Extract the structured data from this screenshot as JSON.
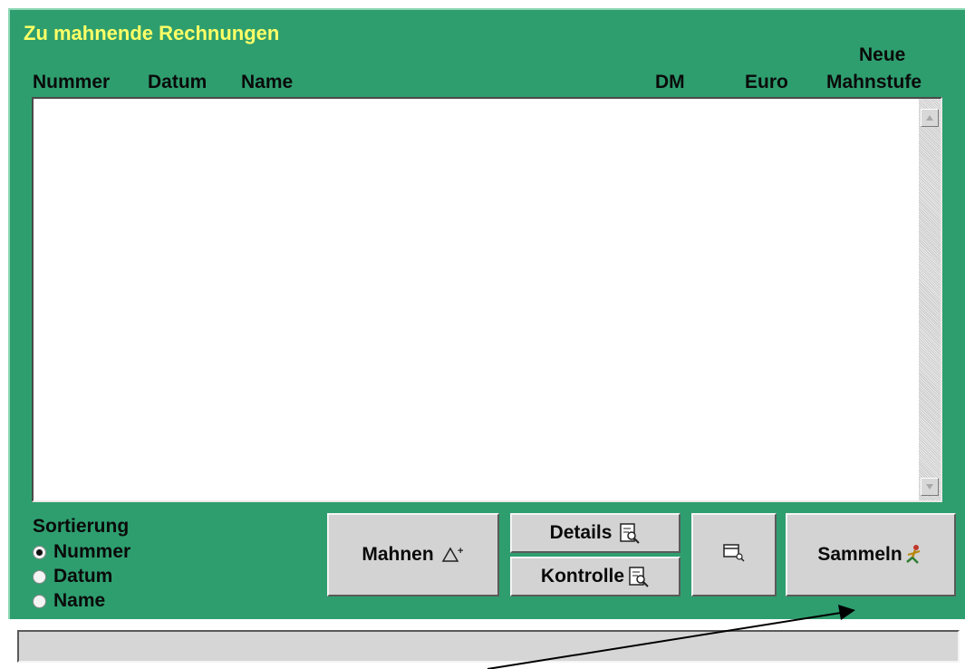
{
  "window": {
    "title": "Zu mahnende Rechnungen"
  },
  "columns": {
    "nummer": "Nummer",
    "datum": "Datum",
    "name": "Name",
    "dm": "DM",
    "euro": "Euro",
    "neue_line1": "Neue",
    "neue_line2": "Mahnstufe"
  },
  "list": {
    "rows": []
  },
  "sorting": {
    "label": "Sortierung",
    "options": [
      {
        "label": "Nummer",
        "selected": true
      },
      {
        "label": "Datum",
        "selected": false
      },
      {
        "label": "Name",
        "selected": false
      }
    ]
  },
  "buttons": {
    "mahnen": "Mahnen",
    "details": "Details",
    "kontrolle": "Kontrolle",
    "sammeln": "Sammeln"
  },
  "status": {
    "text": ""
  },
  "colors": {
    "panel": "#2e9e6f",
    "title": "#ffff66",
    "button": "#d3d3d3"
  }
}
